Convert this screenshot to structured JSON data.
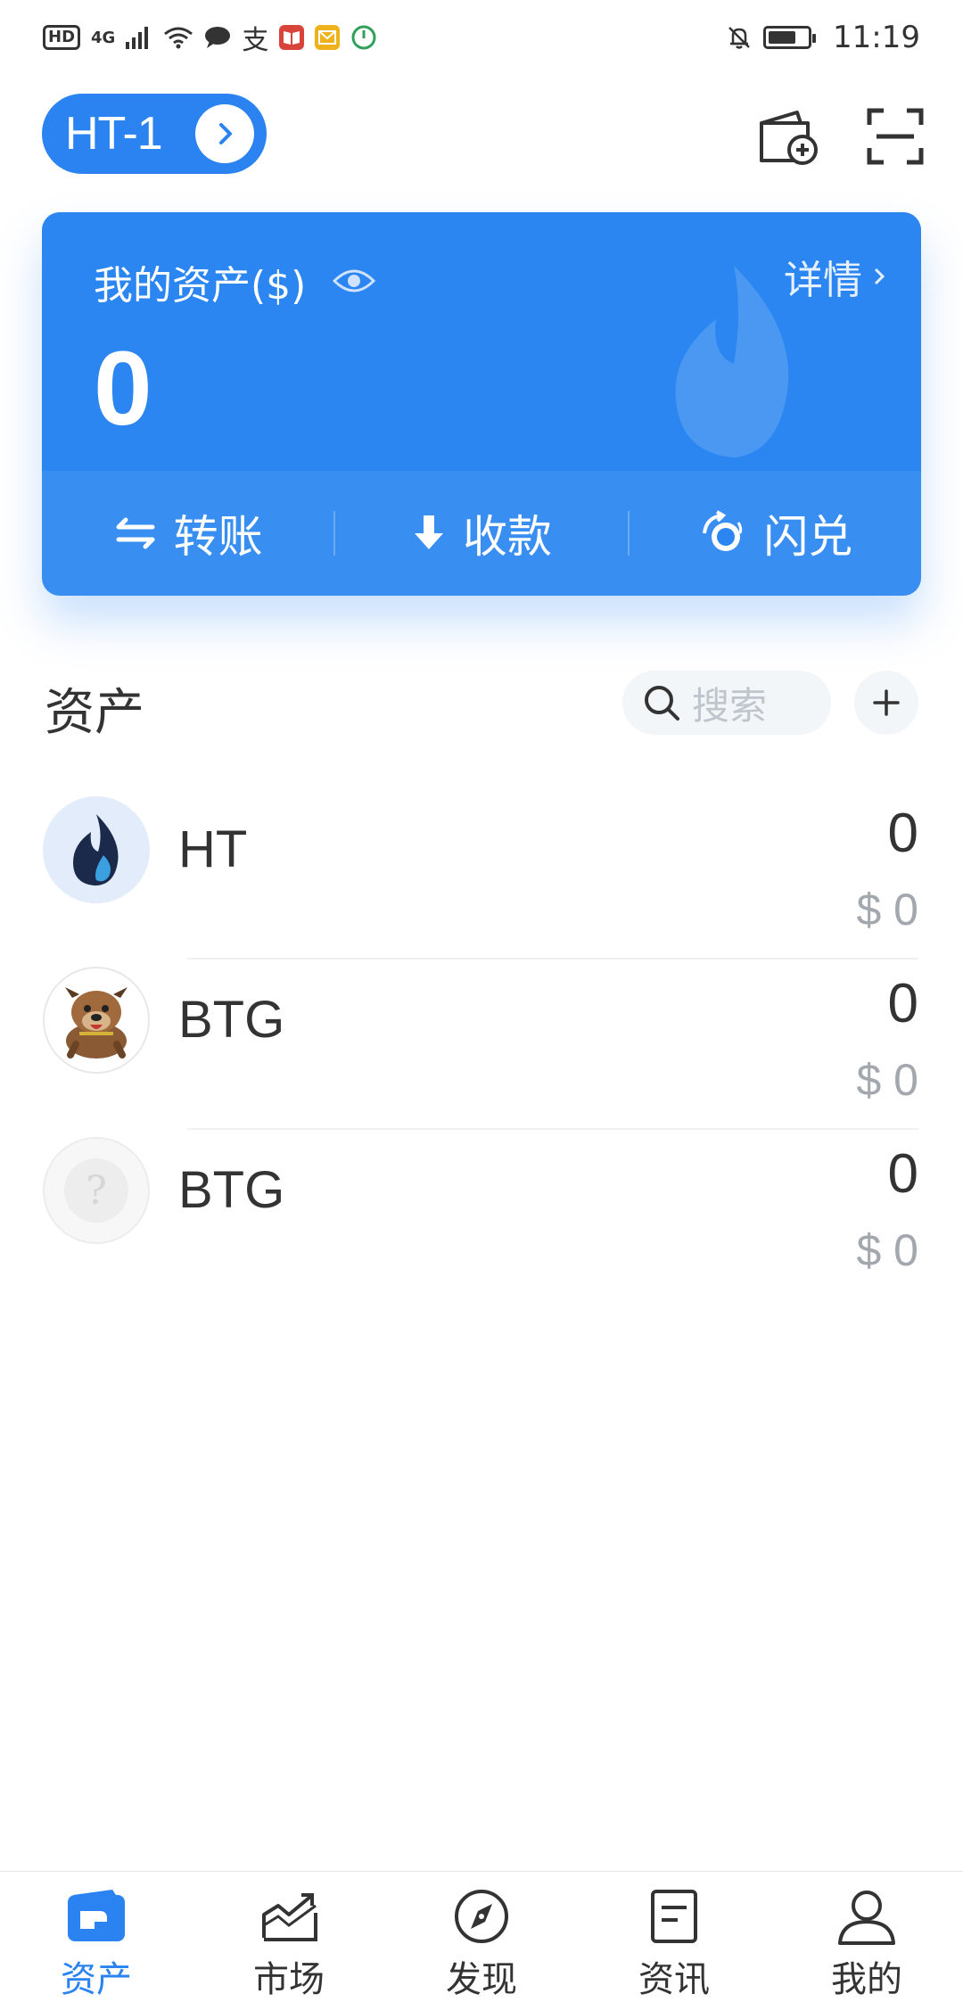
{
  "status_bar": {
    "network": "4G",
    "hd": "HD",
    "time": "11:19"
  },
  "header": {
    "wallet_name": "HT-1",
    "icons": [
      "wallet-add-icon",
      "scan-icon"
    ]
  },
  "asset_card": {
    "title": "我的资产($)",
    "details_label": "详情",
    "balance": "0",
    "actions": [
      {
        "label": "转账",
        "icon": "transfer-icon"
      },
      {
        "label": "收款",
        "icon": "receive-icon"
      },
      {
        "label": "闪兑",
        "icon": "swap-icon"
      }
    ]
  },
  "assets_section": {
    "title": "资产",
    "search_placeholder": "搜索"
  },
  "assets": [
    {
      "symbol": "HT",
      "amount": "0",
      "value": "$ 0",
      "logo": "huobi-flame-logo"
    },
    {
      "symbol": "BTG",
      "amount": "0",
      "value": "$ 0",
      "logo": "bulldog-logo"
    },
    {
      "symbol": "BTG",
      "amount": "0",
      "value": "$ 0",
      "logo": "unknown-token-logo"
    }
  ],
  "tabs": [
    {
      "label": "资产",
      "icon": "assets-icon",
      "active": true
    },
    {
      "label": "市场",
      "icon": "market-icon",
      "active": false
    },
    {
      "label": "发现",
      "icon": "discover-icon",
      "active": false
    },
    {
      "label": "资讯",
      "icon": "news-icon",
      "active": false
    },
    {
      "label": "我的",
      "icon": "profile-icon",
      "active": false
    }
  ],
  "colors": {
    "primary": "#2a83f0",
    "card": "#2b86f2",
    "text": "#333333",
    "muted": "#a3a8ae"
  }
}
